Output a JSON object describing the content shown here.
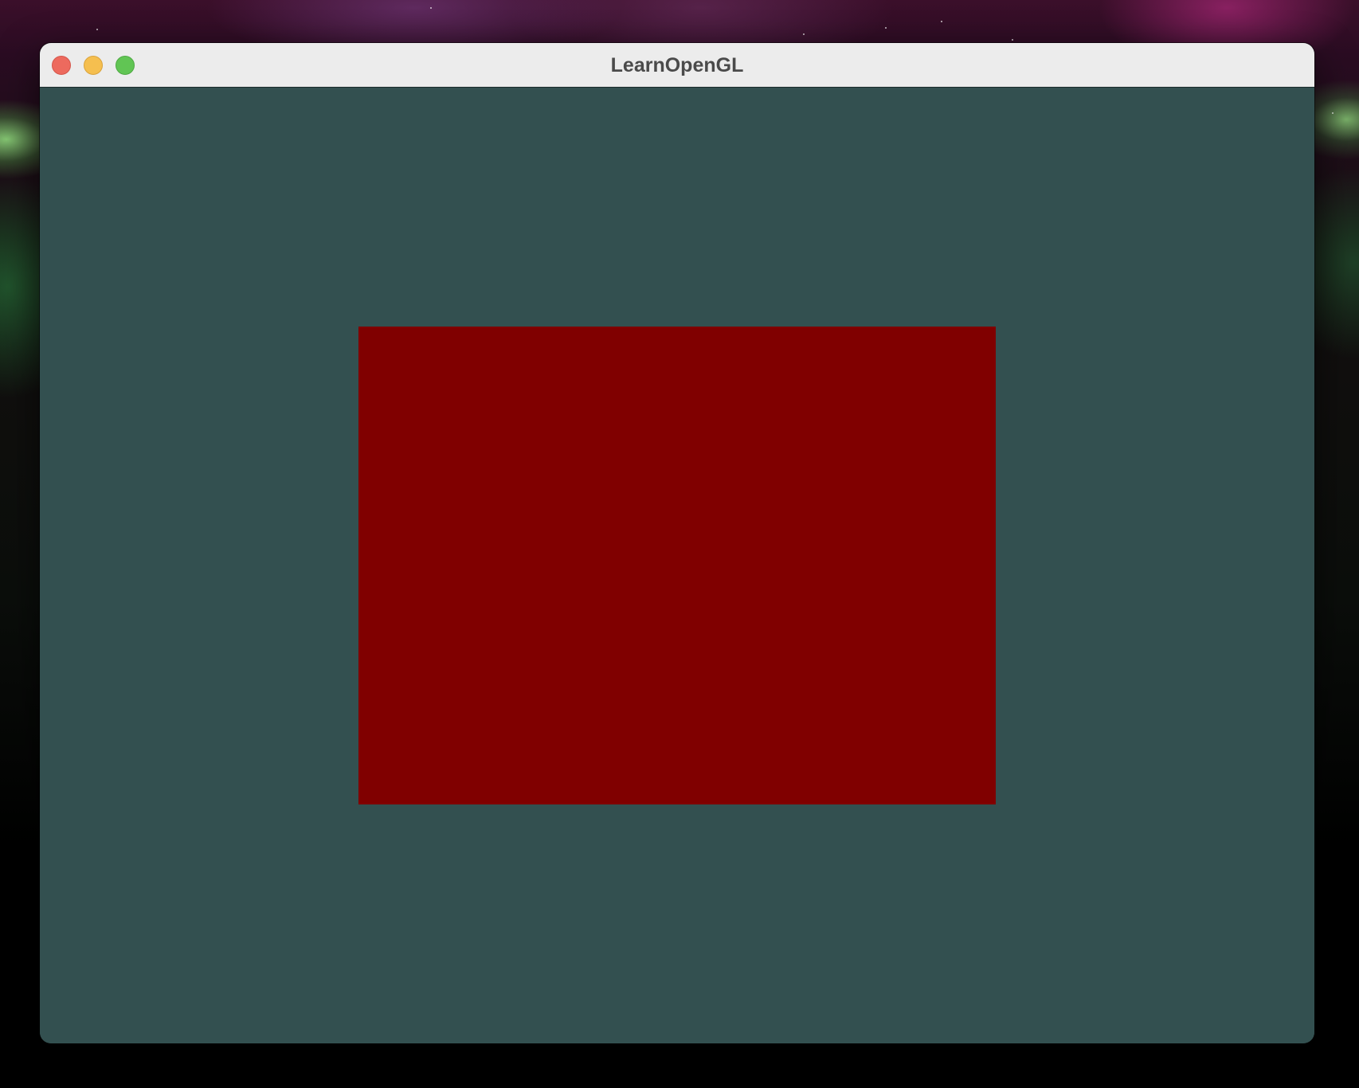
{
  "window": {
    "title": "LearnOpenGL",
    "buttons": {
      "close": "close",
      "minimize": "minimize",
      "zoom": "zoom"
    }
  },
  "colors": {
    "clear_color": "#335050",
    "quad_color": "#800000",
    "titlebar": "#ececec",
    "close_button": "#ed6a5e",
    "minimize_button": "#f5bf4f",
    "zoom_button": "#61c554"
  },
  "icons": {
    "close": "close-icon",
    "minimize": "minimize-icon",
    "zoom": "zoom-icon"
  }
}
